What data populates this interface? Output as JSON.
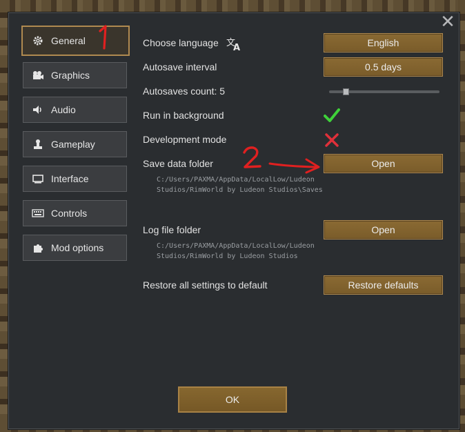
{
  "dialog": {
    "close_icon": "close-icon"
  },
  "sidebar": {
    "items": [
      {
        "label": "General",
        "icon": "gear-icon",
        "selected": true
      },
      {
        "label": "Graphics",
        "icon": "camera-icon"
      },
      {
        "label": "Audio",
        "icon": "speaker-icon"
      },
      {
        "label": "Gameplay",
        "icon": "pawn-icon"
      },
      {
        "label": "Interface",
        "icon": "monitor-icon"
      },
      {
        "label": "Controls",
        "icon": "keyboard-icon"
      },
      {
        "label": "Mod options",
        "icon": "puzzle-icon"
      }
    ]
  },
  "settings": {
    "language": {
      "label": "Choose language",
      "value": "English",
      "icon": "translate-icon"
    },
    "autosave_interval": {
      "label": "Autosave interval",
      "value": "0.5 days"
    },
    "autosaves_count": {
      "label": "Autosaves count: 5",
      "slider_value": 5
    },
    "run_in_background": {
      "label": "Run in background",
      "checked": true
    },
    "development_mode": {
      "label": "Development mode",
      "checked": false
    },
    "save_data_folder": {
      "label": "Save data folder",
      "button": "Open",
      "path_line1": "C:/Users/PAXMA/AppData/LocalLow/Ludeon",
      "path_line2": "Studios/RimWorld by Ludeon Studios\\Saves"
    },
    "log_file_folder": {
      "label": "Log file folder",
      "button": "Open",
      "path_line1": "C:/Users/PAXMA/AppData/LocalLow/Ludeon",
      "path_line2": "Studios/RimWorld by Ludeon Studios"
    },
    "restore": {
      "label": "Restore all settings to default",
      "button": "Restore defaults"
    }
  },
  "footer": {
    "ok_label": "OK"
  },
  "annotations": {
    "marker_1": "1",
    "marker_2": "2"
  },
  "colors": {
    "accent": "#b08a50",
    "check": "#3fd13a",
    "cross": "#e0303a",
    "annotation": "#e02020"
  }
}
